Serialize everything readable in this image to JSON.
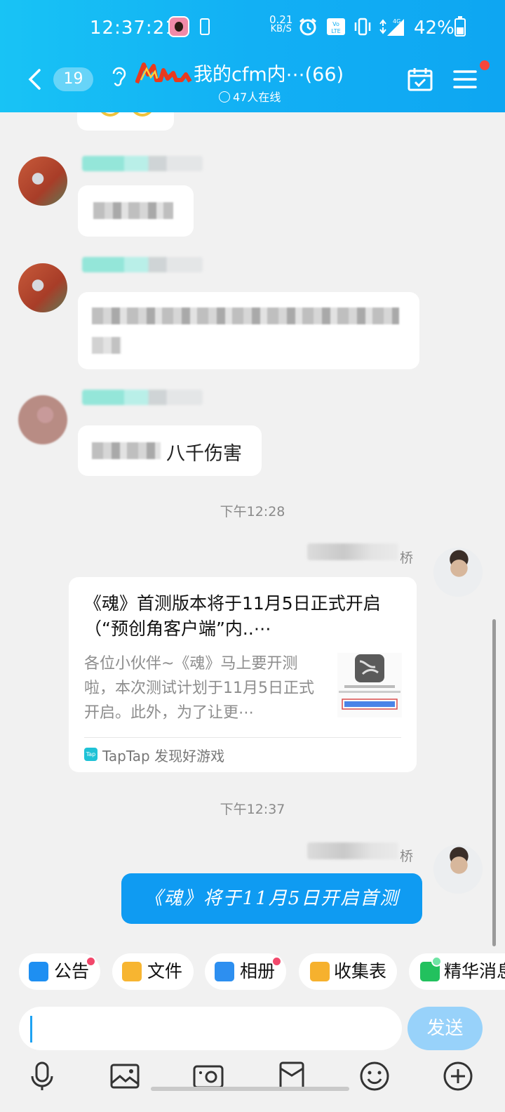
{
  "status_bar": {
    "time": "12:37:21",
    "net_speed_value": "0.21",
    "net_speed_unit": "KB/S",
    "network": "4G",
    "battery": "42%"
  },
  "header": {
    "unread_count": "19",
    "group_title": "我的cfm内⋯(66)",
    "online_text": "47人在线"
  },
  "chat": {
    "messages": [
      {
        "type": "text",
        "text": "八千伤害"
      },
      {
        "type": "timestamp",
        "text": "下午12:28"
      },
      {
        "type": "link_card",
        "sender_suffix": "桥",
        "title": "《魂》首测版本将于11月5日正式开启（“预创角客户端”内..⋯",
        "description": "各位小伙伴~《魂》马上要开测啦，本次测试计划于11月5日正式开启。此外，为了让更⋯",
        "source": "TapTap 发现好游戏"
      },
      {
        "type": "timestamp",
        "text": "下午12:37"
      },
      {
        "type": "text",
        "sender_suffix": "桥",
        "text": "《魂》将于11月5日开启首测"
      }
    ]
  },
  "toolbar": {
    "chips": [
      {
        "label": "公告",
        "icon": "announcement-icon",
        "badge": true
      },
      {
        "label": "文件",
        "icon": "folder-icon",
        "badge": false
      },
      {
        "label": "相册",
        "icon": "album-icon",
        "badge": true
      },
      {
        "label": "收集表",
        "icon": "form-icon",
        "badge": false
      },
      {
        "label": "精华消息",
        "icon": "essence-icon",
        "badge": true
      }
    ]
  },
  "input": {
    "value": "",
    "send_label": "发送"
  },
  "bottom_icons": [
    "microphone-icon",
    "image-icon",
    "camera-icon",
    "red-packet-icon",
    "emoji-icon",
    "plus-icon"
  ],
  "colors": {
    "header": "#12b0f4",
    "my_bubble": "#0f9bf2",
    "send_button": "#98d2fa",
    "badge": "#f2486b"
  }
}
